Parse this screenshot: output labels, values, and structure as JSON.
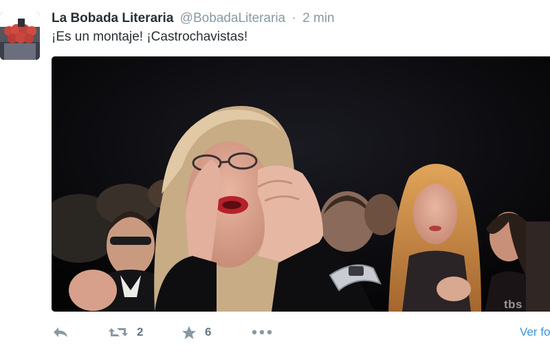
{
  "tweet": {
    "display_name": "La Bobada Literaria",
    "handle": "@BobadaLiteraria",
    "separator": "·",
    "timestamp": "2 min",
    "text": "¡Es un montaje! ¡Castrochavistas!"
  },
  "media": {
    "watermark": "tbs"
  },
  "actions": {
    "reply_icon": "reply-arrow-icon",
    "retweet_icon": "retweet-icon",
    "retweet_count": "2",
    "favorite_icon": "star-icon",
    "favorite_count": "6",
    "more_icon": "ellipsis-icon",
    "view_more": "Ver fo"
  },
  "colors": {
    "name": "#292f33",
    "secondary": "#8899a6",
    "link": "#3b94d9"
  }
}
